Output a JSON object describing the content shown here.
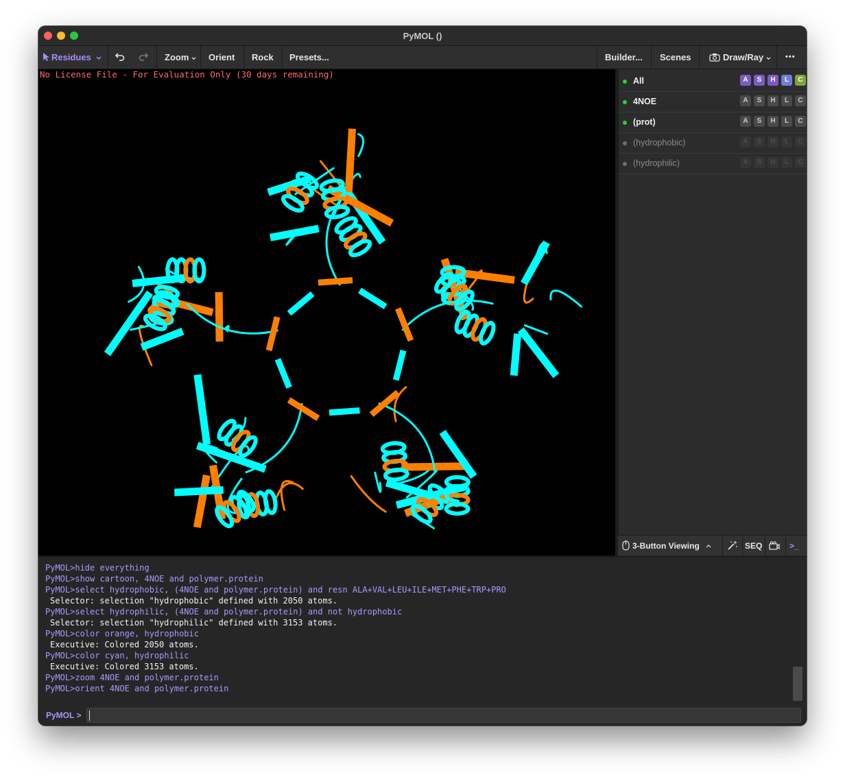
{
  "window": {
    "title": "PyMOL ()"
  },
  "toolbar": {
    "mode_label": "Residues",
    "zoom_label": "Zoom",
    "orient_label": "Orient",
    "rock_label": "Rock",
    "presets_label": "Presets...",
    "builder_label": "Builder...",
    "scenes_label": "Scenes",
    "drawray_label": "Draw/Ray",
    "more_label": "•••"
  },
  "viewport": {
    "license_text": "No License File - For Evaluation Only (30 days remaining)",
    "colors": {
      "hydrophobic": "#ff8000",
      "hydrophilic": "#00ffff",
      "background": "#000000"
    }
  },
  "objects": [
    {
      "name": "All",
      "enabled": true,
      "buttons": [
        "A",
        "S",
        "H",
        "L",
        "C"
      ]
    },
    {
      "name": "4NOE",
      "enabled": true,
      "buttons": [
        "A",
        "S",
        "H",
        "L",
        "C"
      ]
    },
    {
      "name": "(prot)",
      "enabled": true,
      "buttons": [
        "A",
        "S",
        "H",
        "L",
        "C"
      ]
    },
    {
      "name": "(hydrophobic)",
      "enabled": false,
      "buttons": [
        "A",
        "S",
        "H",
        "L",
        "C"
      ]
    },
    {
      "name": "(hydrophilic)",
      "enabled": false,
      "buttons": [
        "A",
        "S",
        "H",
        "L",
        "C"
      ]
    }
  ],
  "panel_bottom": {
    "viewing_mode": "3-Button Viewing",
    "seq_label": "SEQ",
    "console_label": ">_"
  },
  "console": {
    "lines": [
      {
        "kind": "cmd",
        "text": "PyMOL>hide everything"
      },
      {
        "kind": "cmd",
        "text": "PyMOL>show cartoon, 4NOE and polymer.protein"
      },
      {
        "kind": "cmd",
        "text": "PyMOL>select hydrophobic, (4NOE and polymer.protein) and resn ALA+VAL+LEU+ILE+MET+PHE+TRP+PRO"
      },
      {
        "kind": "out",
        "text": "Selector: selection \"hydrophobic\" defined with 2050 atoms."
      },
      {
        "kind": "cmd",
        "text": "PyMOL>select hydrophilic, (4NOE and polymer.protein) and not hydrophobic"
      },
      {
        "kind": "out",
        "text": "Selector: selection \"hydrophilic\" defined with 3153 atoms."
      },
      {
        "kind": "cmd",
        "text": "PyMOL>color orange, hydrophobic"
      },
      {
        "kind": "out",
        "text": "Executive: Colored 2050 atoms."
      },
      {
        "kind": "cmd",
        "text": "PyMOL>color cyan, hydrophilic"
      },
      {
        "kind": "out",
        "text": "Executive: Colored 3153 atoms."
      },
      {
        "kind": "cmd",
        "text": "PyMOL>zoom 4NOE and polymer.protein"
      },
      {
        "kind": "cmd",
        "text": "PyMOL>orient 4NOE and polymer.protein"
      }
    ],
    "prompt": "PyMOL >",
    "input_value": ""
  }
}
